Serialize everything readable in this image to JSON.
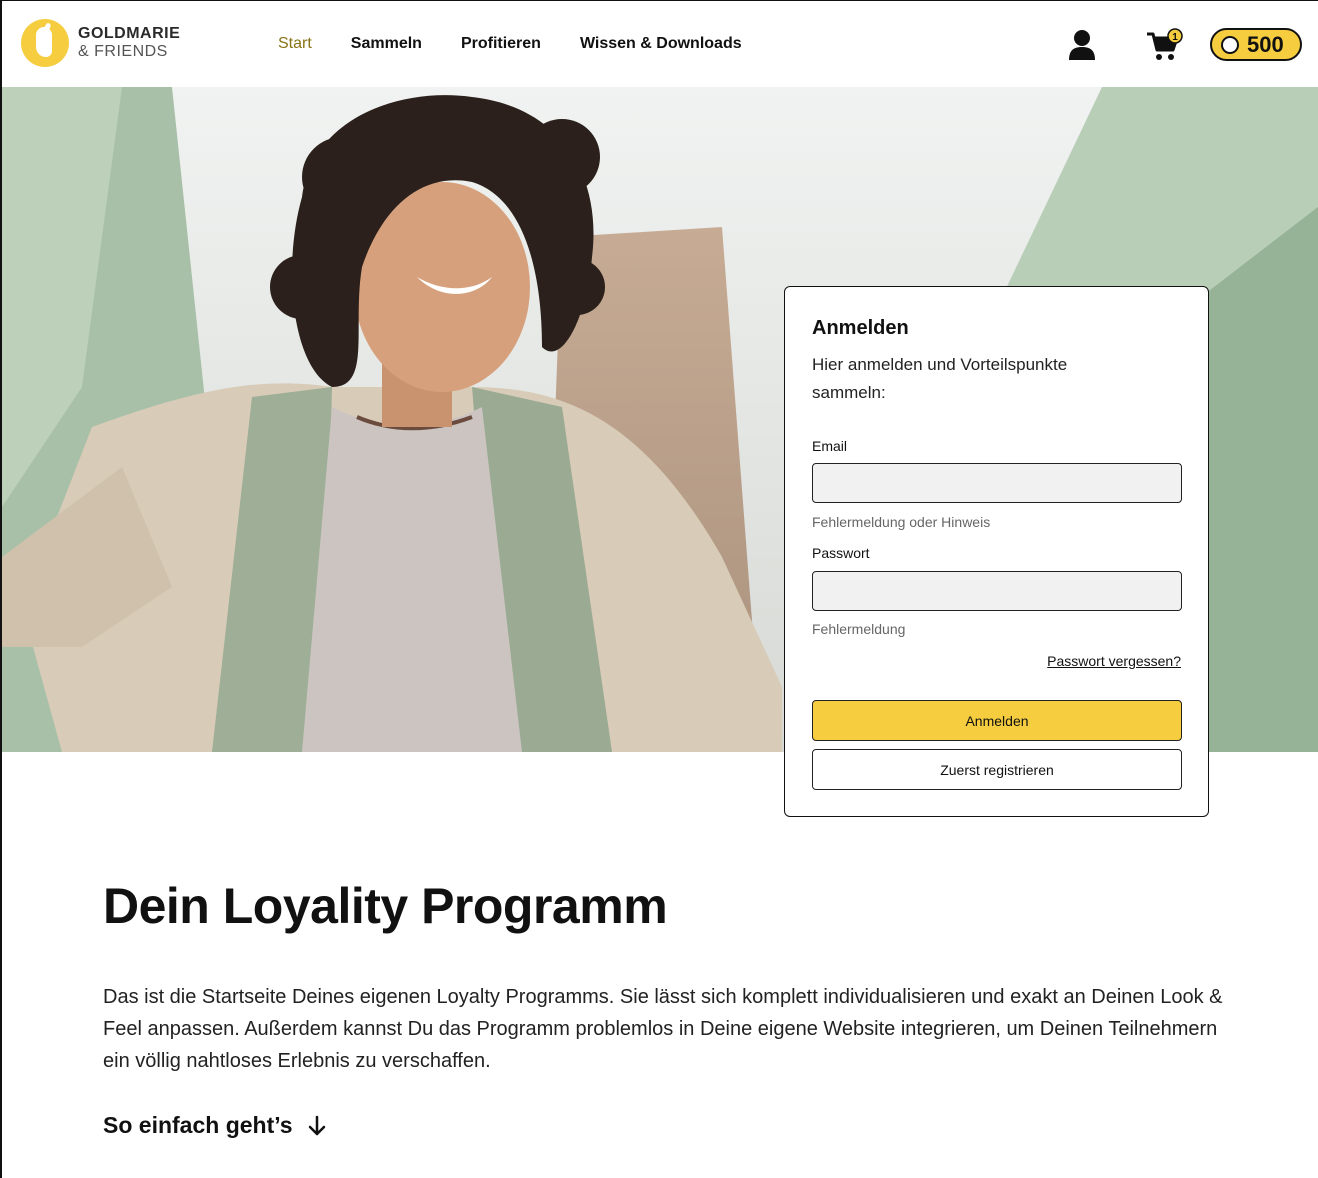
{
  "brand": {
    "line1": "GOLDMARIE",
    "line2": "& FRIENDS",
    "logo_icon": "goldmarie-logo-icon"
  },
  "nav": {
    "items": [
      {
        "label": "Start",
        "active": true
      },
      {
        "label": "Sammeln",
        "active": false
      },
      {
        "label": "Profitieren",
        "active": false
      },
      {
        "label": "Wissen & Downloads",
        "active": false
      }
    ]
  },
  "header_actions": {
    "user_icon": "user-icon",
    "cart_icon": "cart-icon",
    "cart_count": "1",
    "points": "500"
  },
  "colors": {
    "accent": "#f6cd3e",
    "active_nav": "#8a7317",
    "text": "#111111"
  },
  "login": {
    "title": "Anmelden",
    "subtitle": "Hier anmelden und Vorteilspunkte sammeln:",
    "email_label": "Email",
    "email_value": "",
    "email_hint": "Fehlermeldung oder Hinweis",
    "password_label": "Passwort",
    "password_value": "",
    "password_hint": "Fehlermeldung",
    "forgot_label": "Passwort vergessen?",
    "submit_label": "Anmelden",
    "register_label": "Zuerst registrieren"
  },
  "content": {
    "title": "Dein Loyality Programm",
    "text": "Das ist die Startseite Deines eigenen Loyalty Programms. Sie lässt sich komplett individualisieren und exakt an Deinen Look & Feel anpassen. Außerdem kannst Du das Programm problemlos in Deine eigene Website integrieren, um Deinen Teilnehmern ein völlig nahtloses Erlebnis zu verschaffen.",
    "how_link": "So einfach geht’s"
  }
}
